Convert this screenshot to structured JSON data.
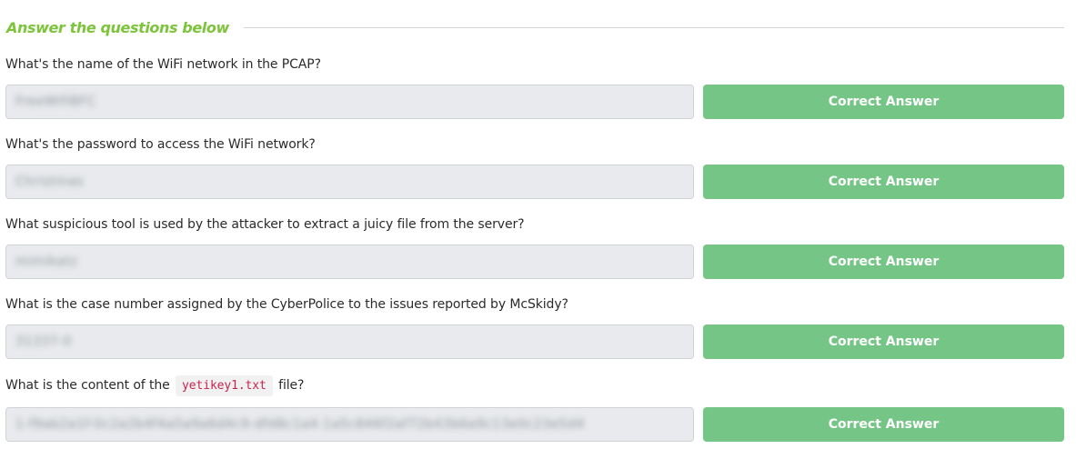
{
  "section": {
    "title": "Answer the questions below"
  },
  "questions": [
    {
      "label": "What's the name of the WiFi network in the PCAP?",
      "answer": "FreeWifiBFC",
      "button_label": "Correct Answer"
    },
    {
      "label": "What's the password to access the WiFi network?",
      "answer": "Christmas",
      "button_label": "Correct Answer"
    },
    {
      "label": "What suspicious tool is used by the attacker to extract a juicy file from the server?",
      "answer": "mimikatz",
      "button_label": "Correct Answer"
    },
    {
      "label": "What is the case number assigned by the CyberPolice to the issues reported by McSkidy?",
      "answer": "31337-0",
      "button_label": "Correct Answer"
    },
    {
      "label_before": "What is the content of the",
      "label_code": "yetikey1.txt",
      "label_after": "file?",
      "answer": "1-f9ab2a1f-0c2a2b4f4a5a9a6d4c9-dfd8c1a4-1a5c846f2af72b43b6a9c13e0c23e5d4",
      "button_label": "Correct Answer"
    }
  ],
  "colors": {
    "title": "#7cc43a",
    "button": "#75c686",
    "field": "#e8eaed",
    "code_text": "#c7254e"
  }
}
